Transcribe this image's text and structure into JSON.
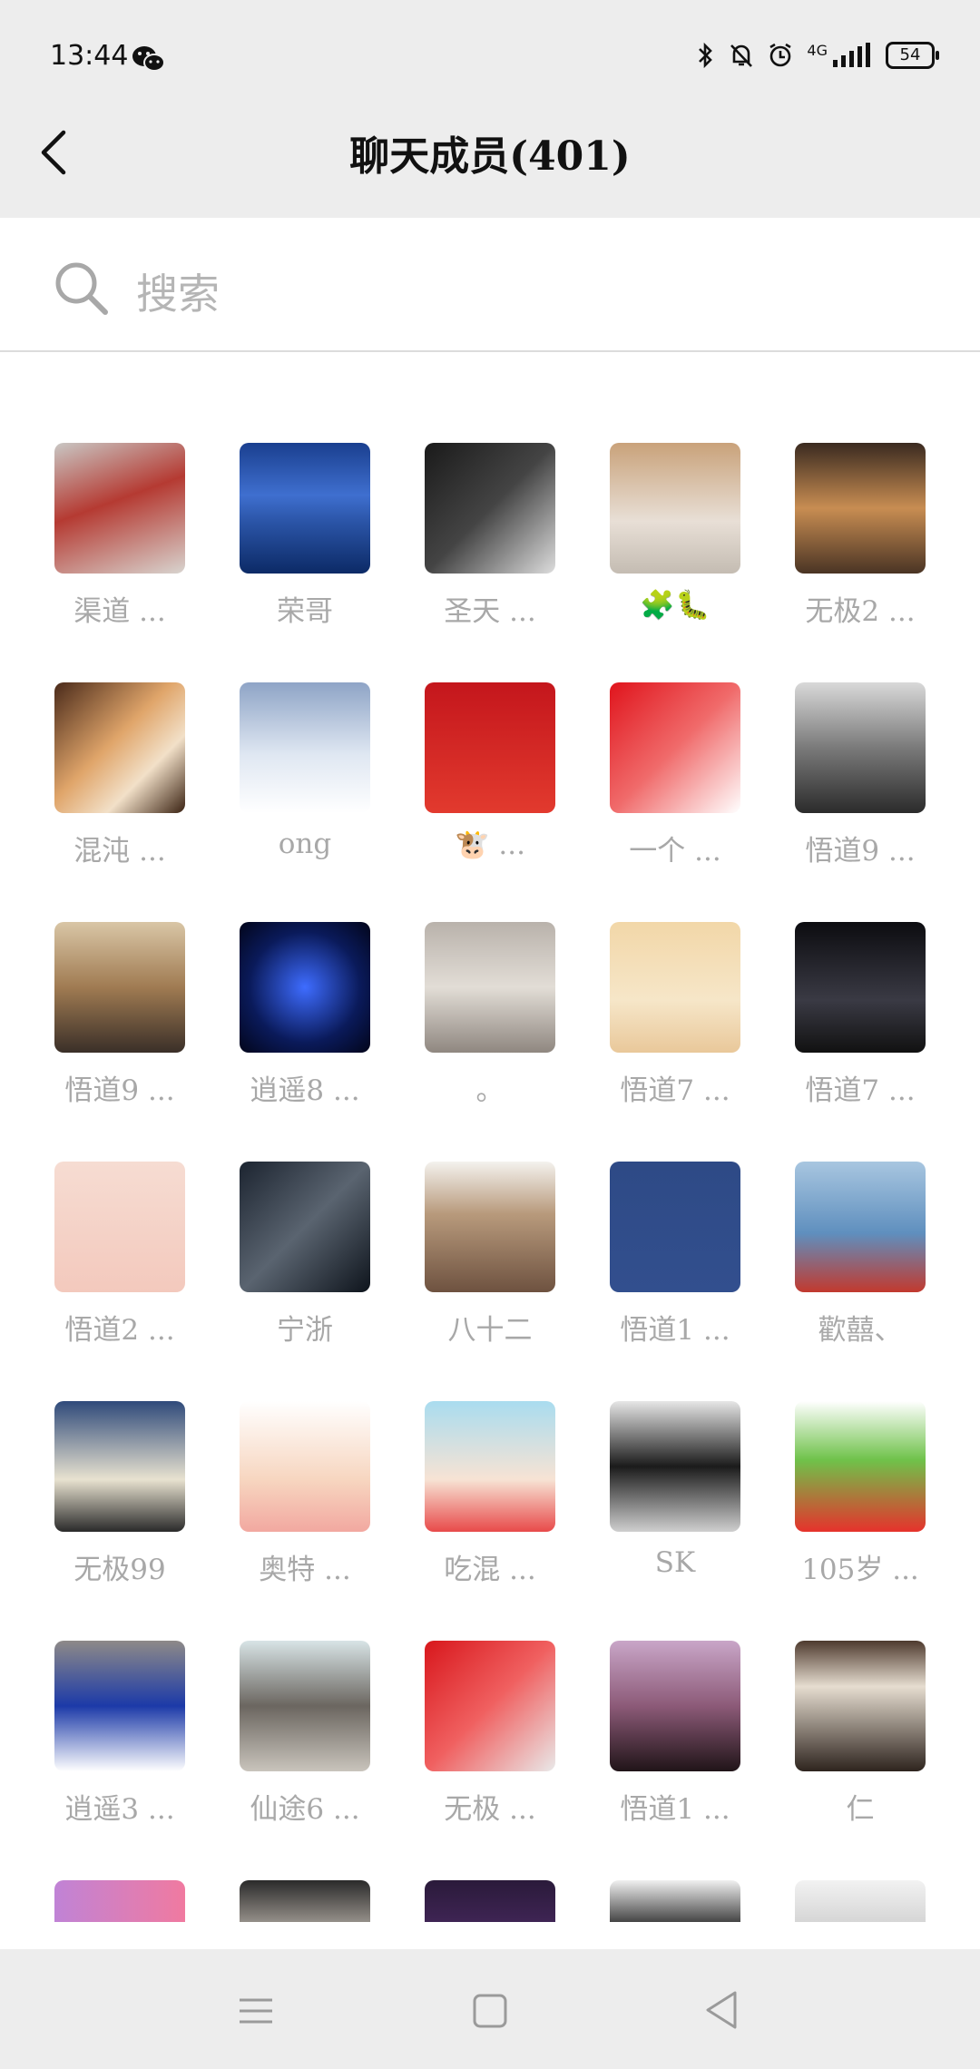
{
  "status": {
    "time": "13:44",
    "signal": "4G",
    "battery": "54"
  },
  "header": {
    "title": "聊天成员(401)"
  },
  "search": {
    "placeholder": "搜索"
  },
  "members": [
    {
      "name": "渠道 ...",
      "bg": "linear-gradient(160deg,#c9c7c4 0%,#b53a32 45%,#d8d4cf 100%)",
      "icon": "ultraman-avatar"
    },
    {
      "name": "荣哥",
      "bg": "linear-gradient(180deg,#1a3f8f 0%,#3f6fcf 40%,#2b55a8 60%,#0c2a66 100%)",
      "icon": "moon-lake-avatar"
    },
    {
      "name": "圣天 ...",
      "bg": "linear-gradient(135deg,#1a1a1a 0%,#444 50%,#ddd 100%)",
      "icon": "anime-boy-avatar"
    },
    {
      "name": "🧩🐛",
      "bg": "linear-gradient(180deg,#c9a27a 0%,#e8dfd6 60%,#c4bcb2 100%)",
      "icon": "corgi-avatar"
    },
    {
      "name": "无极2 ...",
      "bg": "linear-gradient(180deg,#3a2a20 0%,#c88d52 50%,#4a3424 100%)",
      "icon": "shiba-avatar"
    },
    {
      "name": "混沌 ...",
      "bg": "linear-gradient(135deg,#4a2a1a 0%,#e0a56a 45%,#f2e0c8 70%,#3a2212 100%)",
      "icon": "kitten-avatar"
    },
    {
      "name": "ong",
      "bg": "linear-gradient(180deg,#8ea4c6 0%,#dfe7f2 55%,#ffffff 100%)",
      "icon": "snow-cabin-avatar"
    },
    {
      "name": "🐮 ...",
      "bg": "linear-gradient(180deg,#c4161c 0%,#e23a2e 100%)",
      "icon": "cow-cartoon-avatar"
    },
    {
      "name": "一个 ...",
      "bg": "linear-gradient(135deg,#e0141c 0%,#f06a6a 50%,#ffffff 100%)",
      "icon": "china-flag-avatar"
    },
    {
      "name": "悟道9 ...",
      "bg": "linear-gradient(180deg,#d9d9d9 0%,#7a7a7a 50%,#2b2b2b 100%)",
      "icon": "bw-portrait-avatar"
    },
    {
      "name": "悟道9 ...",
      "bg": "linear-gradient(180deg,#d9c6a6 0%,#a07b52 50%,#3a2f28 100%)",
      "icon": "group-photo-avatar"
    },
    {
      "name": "逍遥8 ...",
      "bg": "radial-gradient(circle at 50% 50%,#3e6cff 0%,#0a1a5a 60%,#02051a 100%)",
      "icon": "scorpion-avatar"
    },
    {
      "name": "。",
      "bg": "linear-gradient(180deg,#b9b2ab 0%,#e2ddd6 50%,#8f8780 100%)",
      "icon": "grey-cat-avatar"
    },
    {
      "name": "悟道7 ...",
      "bg": "linear-gradient(180deg,#f2d7a8 0%,#f6e6c8 60%,#e9c89a 100%)",
      "icon": "crayon-shin-avatar"
    },
    {
      "name": "悟道7 ...",
      "bg": "linear-gradient(180deg,#0c0c10 0%,#3a3a44 60%,#111 100%)",
      "icon": "dark-anime-avatar"
    },
    {
      "name": "悟道2 ...",
      "bg": "linear-gradient(180deg,#f6dcd2 0%,#f3c9bd 100%)",
      "icon": "glasses-girl-avatar"
    },
    {
      "name": "宁浙",
      "bg": "linear-gradient(135deg,#1c2430 0%,#5a6470 50%,#0e141c 100%)",
      "icon": "car-wheel-avatar"
    },
    {
      "name": "八十二",
      "bg": "linear-gradient(180deg,#f4f2ee 0%,#b89a7c 40%,#6e5240 100%)",
      "icon": "child-photo-avatar"
    },
    {
      "name": "悟道1 ...",
      "bg": "linear-gradient(180deg,#2e4a86 0%,#324f8e 100%)",
      "icon": "patrick-avatar"
    },
    {
      "name": "歡囍、",
      "bg": "linear-gradient(180deg,#a8c6e0 0%,#5f8fbe 55%,#c2392e 100%)",
      "icon": "couple-beach-avatar"
    },
    {
      "name": "无极99",
      "bg": "linear-gradient(180deg,#2f4a7a 0%,#e8e2d0 60%,#2a2a2a 100%)",
      "icon": "flower-back-avatar"
    },
    {
      "name": "奥特 ...",
      "bg": "linear-gradient(180deg,#ffffff 0%,#f7d6c0 60%,#f2a8a0 100%)",
      "icon": "crayon-shin-2-avatar"
    },
    {
      "name": "吃混 ...",
      "bg": "linear-gradient(180deg,#a9dcef 0%,#f7e3d4 60%,#e84a4a 100%)",
      "icon": "cartoon-girl-avatar"
    },
    {
      "name": "SK",
      "bg": "linear-gradient(180deg,#e6e6e6 0%,#1b1b1b 50%,#cfcfcf 100%)",
      "icon": "police-car-avatar"
    },
    {
      "name": "105岁 ...",
      "bg": "linear-gradient(180deg,#ffffff 0%,#6fc24a 45%,#e6322c 100%)",
      "icon": "frog-cartoon-avatar"
    },
    {
      "name": "逍遥3 ...",
      "bg": "linear-gradient(180deg,#8e8a88 0%,#1c3aa8 50%,#ffffff 100%)",
      "icon": "tracksuit-avatar"
    },
    {
      "name": "仙途6 ...",
      "bg": "linear-gradient(180deg,#d8e4e6 0%,#6b6660 50%,#c9c4bc 100%)",
      "icon": "raccoon-avatar"
    },
    {
      "name": "无极 ...",
      "bg": "linear-gradient(135deg,#d8171c 0%,#f06060 50%,#e9e9e9 100%)",
      "icon": "flag-runner-avatar"
    },
    {
      "name": "悟道1 ...",
      "bg": "linear-gradient(180deg,#c9a6c8 0%,#8c5a78 50%,#201418 100%)",
      "icon": "woman-portrait-avatar"
    },
    {
      "name": "仁",
      "bg": "linear-gradient(180deg,#4e3a2e 0%,#e6ddd0 35%,#2e241e 100%)",
      "icon": "calligraphy-avatar"
    },
    {
      "name": "",
      "bg": "linear-gradient(90deg,#c083d6 0%,#f07aa0 100%)",
      "icon": "gradient-avatar"
    },
    {
      "name": "",
      "bg": "linear-gradient(180deg,#2a2a2a 0%,#f2e8dc 60%,#fff 100%)",
      "icon": "dog-white-avatar"
    },
    {
      "name": "",
      "bg": "linear-gradient(180deg,#2a1a3a 0%,#6a3a8a 100%)",
      "icon": "dark-purple-avatar"
    },
    {
      "name": "",
      "bg": "linear-gradient(180deg,#f0f0f0 0%,#1a1a1a 40%,#f0f0f0 100%)",
      "icon": "panda-avatar"
    },
    {
      "name": "",
      "bg": "linear-gradient(180deg,#f2f2f2 0%,#9a9a9a 100%)",
      "icon": "sketch-avatar"
    }
  ],
  "nav": {
    "menu_label": "menu",
    "home_label": "home",
    "back_label": "back"
  }
}
